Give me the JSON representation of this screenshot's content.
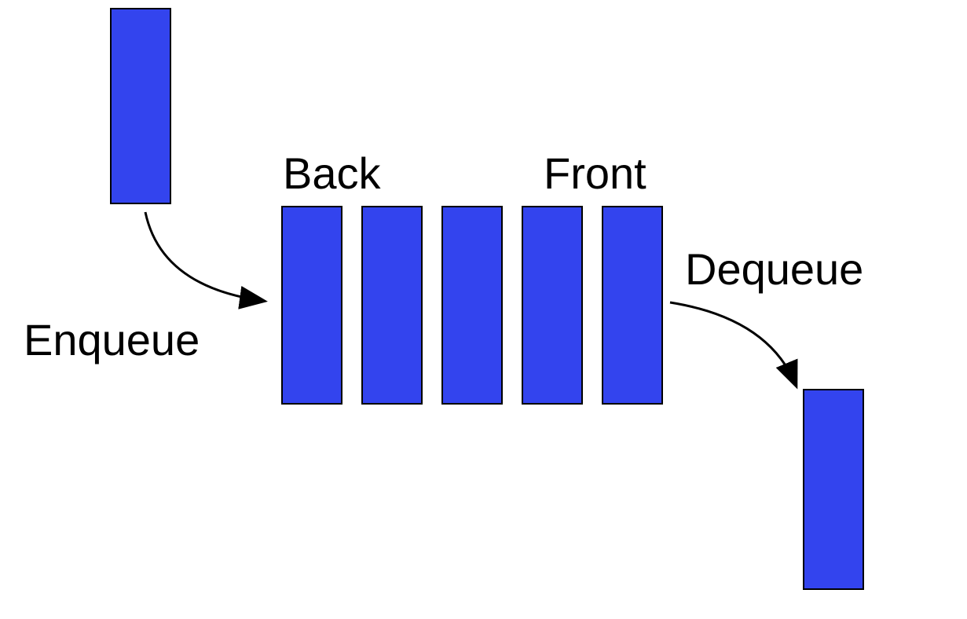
{
  "labels": {
    "back": "Back",
    "front": "Front",
    "enqueue": "Enqueue",
    "dequeue": "Dequeue"
  },
  "colors": {
    "block_fill": "#3344ee",
    "block_stroke": "#000000",
    "text": "#000000",
    "arrow": "#000000"
  },
  "diagram": {
    "type": "queue",
    "operations": [
      "enqueue",
      "dequeue"
    ],
    "ends": {
      "back": "enqueue",
      "front": "dequeue"
    },
    "queue_size": 5
  }
}
